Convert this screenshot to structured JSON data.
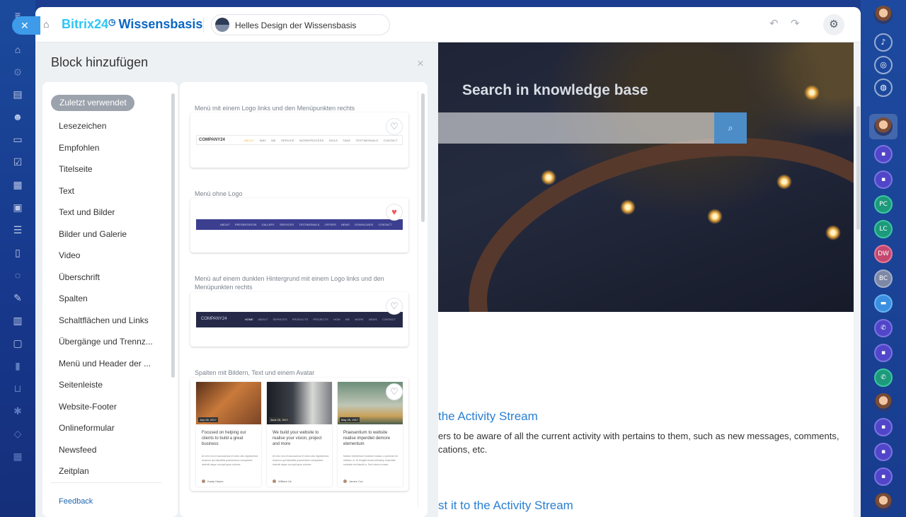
{
  "window": {
    "brand_part1": "Bitrix24",
    "brand_clock": "◷",
    "brand_part2": "Wissensbasis",
    "site_name": "Helles Design der Wissensbasis"
  },
  "icons": {
    "home": "⌂",
    "undo": "↶",
    "redo": "↷",
    "settings": "⚙",
    "close": "×",
    "heart_empty": "♡",
    "heart_full": "♥",
    "search": "⌕"
  },
  "panel": {
    "title": "Block hinzufügen",
    "active_category": "Zuletzt verwendet",
    "categories": [
      "Lesezeichen",
      "Empfohlen",
      "Titelseite",
      "Text",
      "Text und Bilder",
      "Bilder und Galerie",
      "Video",
      "Überschrift",
      "Spalten",
      "Schaltflächen und Links",
      "Übergänge und Trennz...",
      "Menü und Header der ...",
      "Seitenleiste",
      "Website-Footer",
      "Onlineformular",
      "Newsfeed",
      "Zeitplan"
    ],
    "feedback": "Feedback"
  },
  "blocks": [
    {
      "label": "Menü mit einem Logo links und den Menüpunkten rechts",
      "favorite": false,
      "logo": "COMPANY24",
      "menu": [
        "ABOUT",
        "WAY ME",
        "SERVICE",
        "WORKPROCESS",
        "SKILS",
        "TAKE",
        "TESTIMONIALS",
        "CONTACT"
      ]
    },
    {
      "label": "Menü ohne Logo",
      "favorite": true,
      "menu": [
        "ABOUT",
        "PRESENTATION",
        "GALLERY",
        "SERVICES",
        "TESTIMONIALS",
        "OFFERS",
        "NEWS",
        "DOWNLOADS",
        "CONTACT"
      ]
    },
    {
      "label": "Menü auf einem dunklen Hintergrund mit einem Logo links und den Menüpunkten rechts",
      "favorite": false,
      "logo": "COMPANY24",
      "menu": [
        "HOME",
        "ABOUT",
        "SERVICES",
        "PRODUCTS",
        "PROJECTS",
        "HOW WE WORK",
        "NEWS",
        "CONTACT"
      ]
    },
    {
      "label": "Spalten mit Bildern, Text und einem Avatar",
      "favorite": false,
      "columns": [
        {
          "date": "July 08, 2017",
          "title": "Focused on helping our clients to build a great business",
          "body": "At vero eos et accusamus et iusto odio dignissimos ducimus qui blanditiis praesentium voluptatum deleniti atque corrupti quos dolores",
          "author": "Kasty Hayes"
        },
        {
          "date": "June 15, 2017",
          "title": "We build your website to realise your vision, project and more",
          "body": "At vero eos et accusamus et iusto odio dignissimos ducimus qui blanditiis praesentium voluptatum deleniti atque corrupti quos dolores",
          "author": "William Uk"
        },
        {
          "date": "May 26, 2017",
          "title": "Praesentium to website realise imperdiet demore elementum",
          "body": "Nullam elementum tincidunt massa, a pulvinar leo ultricies ut. Ut fringilla lectus tellusimp imperdiet molestie est blandit a. Sed viverra ornare",
          "author": "James Cox"
        }
      ]
    }
  ],
  "preview": {
    "hero_title": "Search in knowledge base",
    "link1": "the Activity Stream",
    "text1a": "ers to be aware of all the current activity with pertains to them, such as new messages, comments,",
    "text1b": "cations, etc.",
    "link2": "st it to the Activity Stream"
  },
  "right_rail": {
    "initials": [
      "PC",
      "LC",
      "DW",
      "BC"
    ]
  }
}
